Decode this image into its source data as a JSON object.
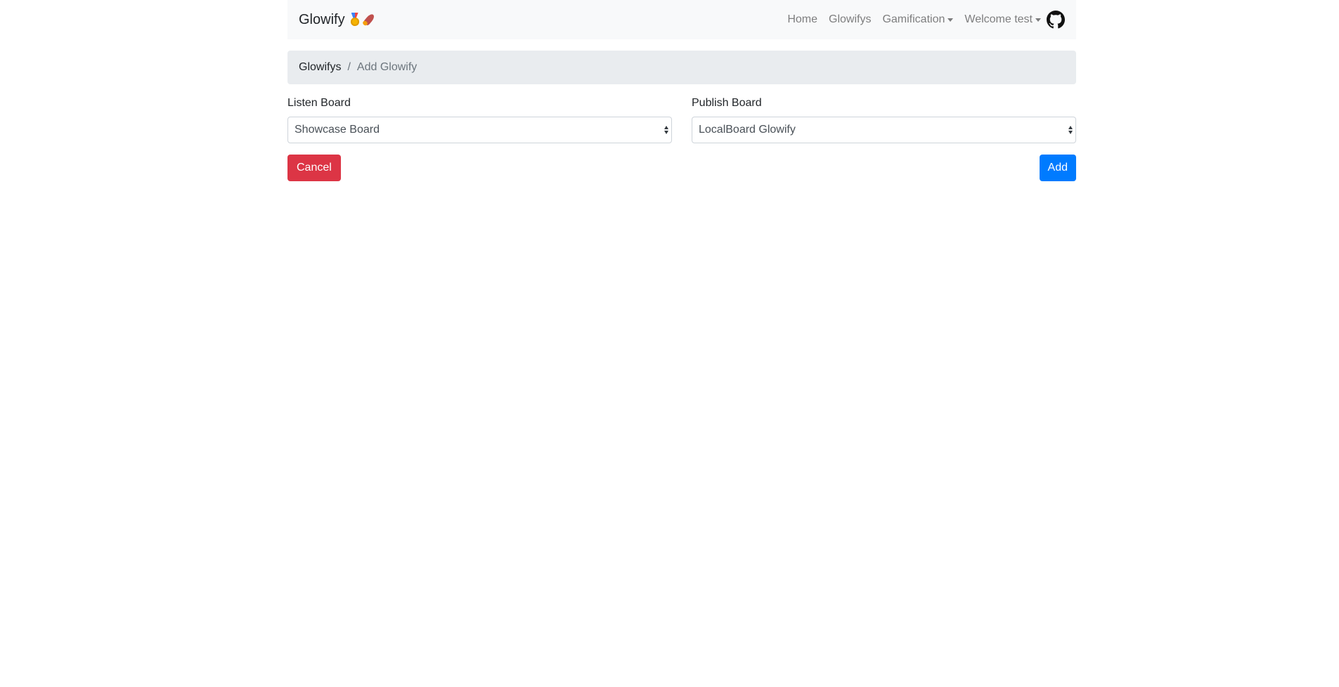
{
  "navbar": {
    "brand": "Glowify",
    "brand_icons": [
      "medal-icon",
      "rocket-icon"
    ],
    "links": {
      "home": "Home",
      "glowifys": "Glowifys",
      "gamification": "Gamification",
      "welcome": "Welcome test"
    },
    "github_icon": "github-icon"
  },
  "breadcrumb": {
    "parent": "Glowifys",
    "separator": "/",
    "current": "Add Glowify"
  },
  "form": {
    "listen_board": {
      "label": "Listen Board",
      "selected": "Showcase Board"
    },
    "publish_board": {
      "label": "Publish Board",
      "selected": "LocalBoard Glowify"
    },
    "cancel_label": "Cancel",
    "add_label": "Add"
  },
  "colors": {
    "navbar_bg": "#f8f9fa",
    "breadcrumb_bg": "#e9ecef",
    "danger": "#dc3545",
    "primary": "#007bff"
  }
}
